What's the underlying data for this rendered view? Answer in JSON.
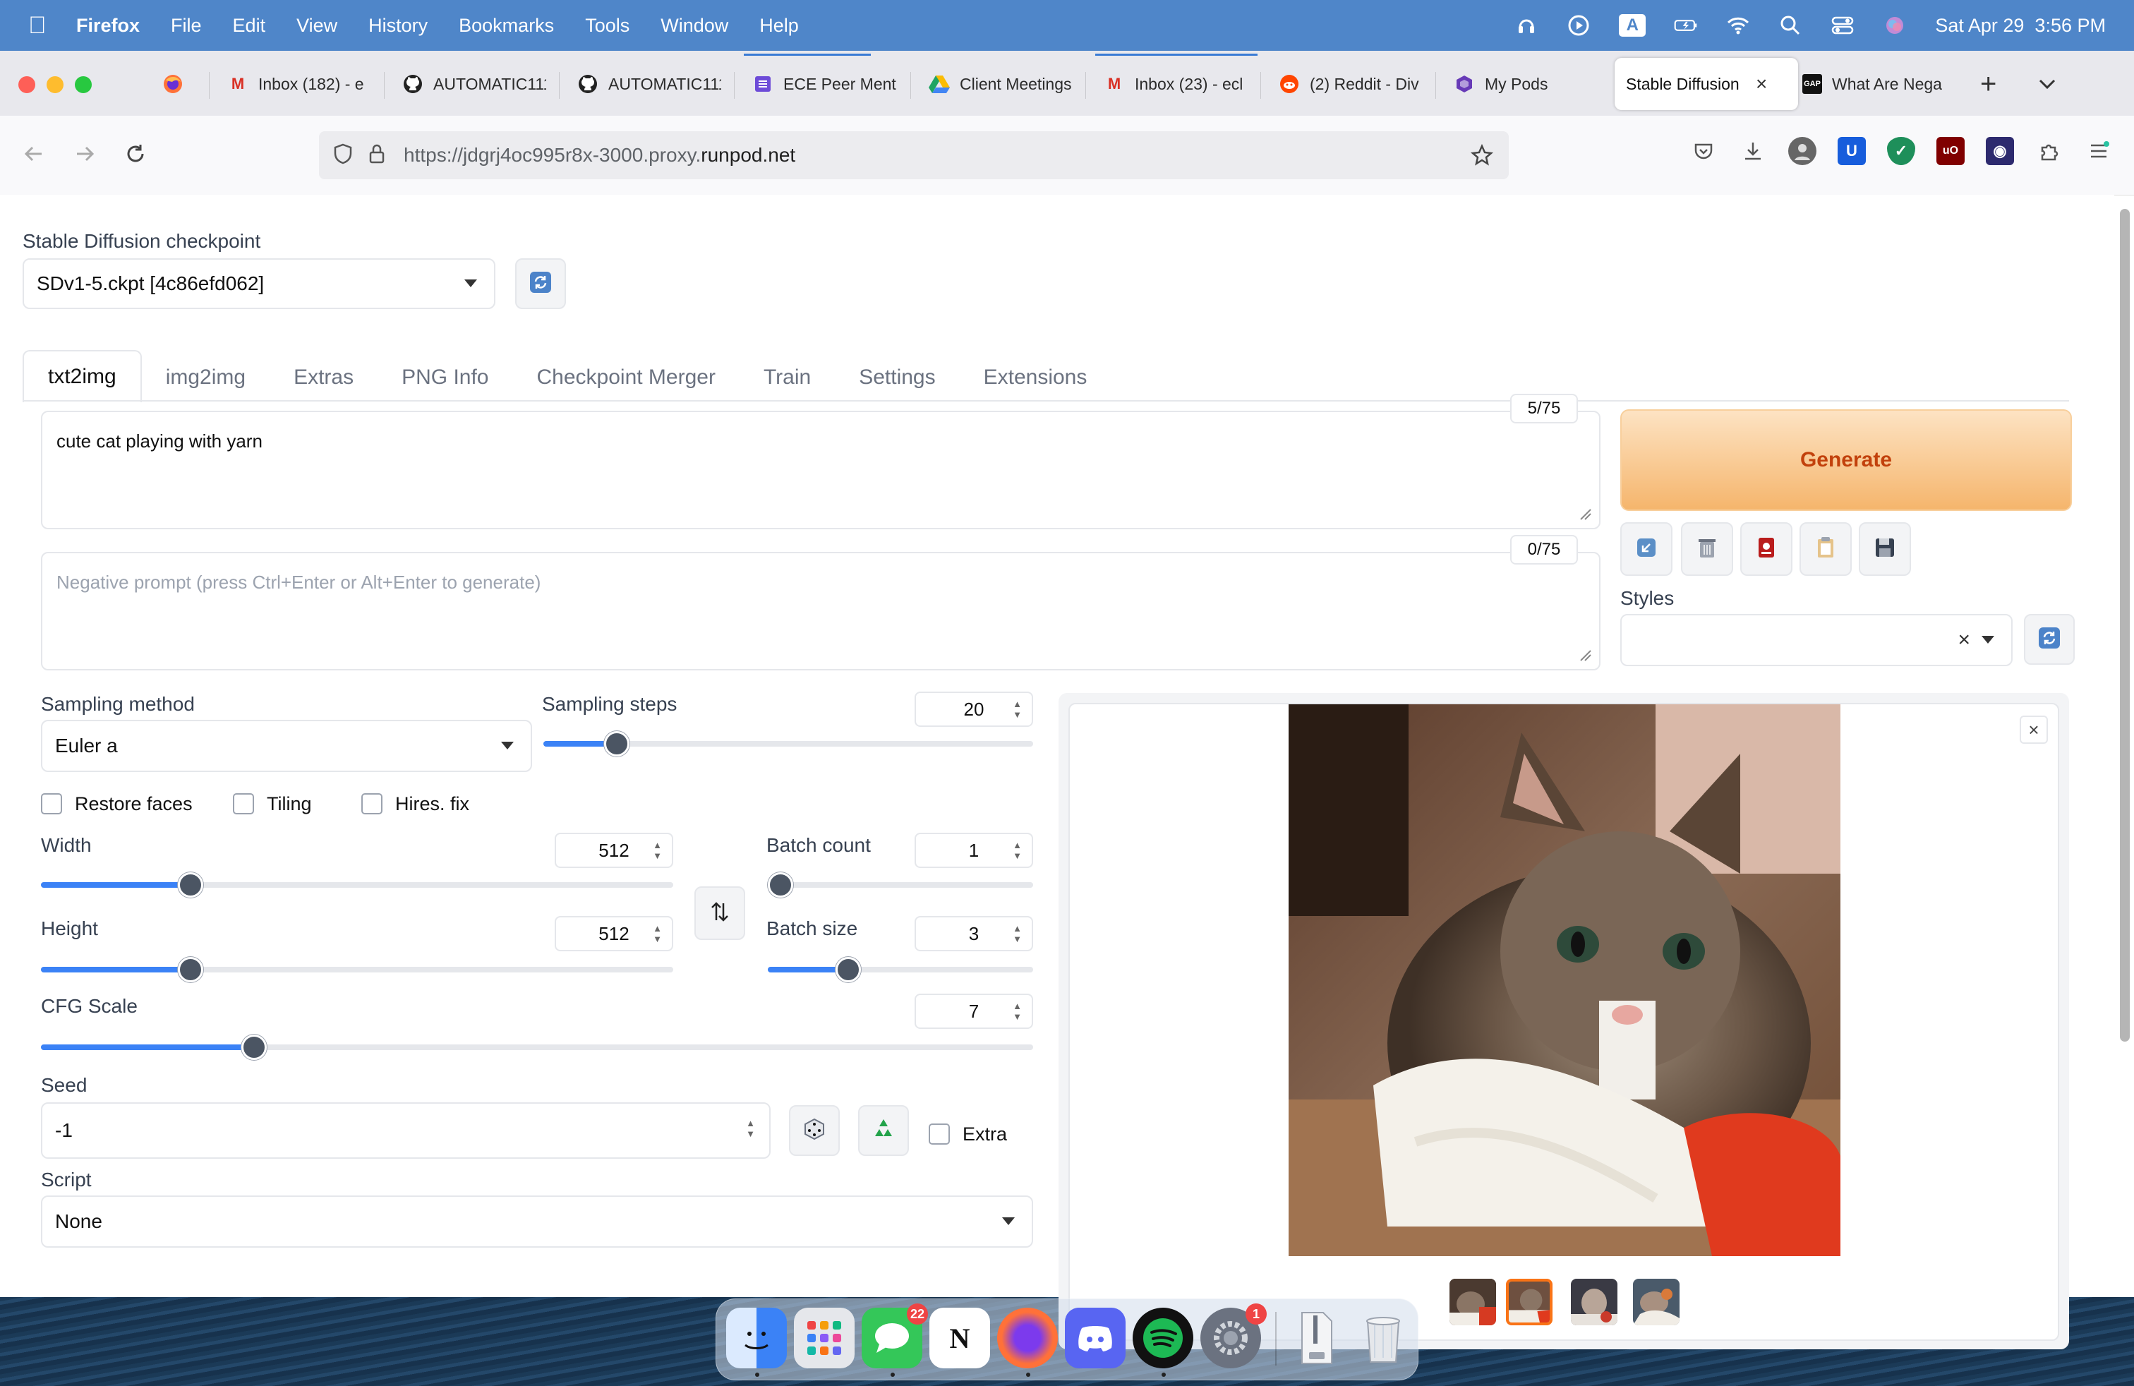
{
  "menubar": {
    "app_name": "Firefox",
    "items": [
      "File",
      "Edit",
      "View",
      "History",
      "Bookmarks",
      "Tools",
      "Window",
      "Help"
    ],
    "datetime": "Sat Apr 29  3:56 PM",
    "input_source": "A"
  },
  "browser": {
    "tabs": [
      {
        "title": "Inbox (182) - e",
        "icon": "gmail-icon"
      },
      {
        "title": "AUTOMATIC111",
        "icon": "github-icon"
      },
      {
        "title": "AUTOMATIC111",
        "icon": "github-icon"
      },
      {
        "title": "ECE Peer Ment",
        "icon": "form-icon"
      },
      {
        "title": "Client Meetings",
        "icon": "google-drive-icon"
      },
      {
        "title": "Inbox (23) - ecl",
        "icon": "gmail-icon"
      },
      {
        "title": "(2) Reddit - Div",
        "icon": "reddit-icon"
      },
      {
        "title": "My Pods",
        "icon": "runpod-icon"
      },
      {
        "title": "Stable Diffusion",
        "icon": "none",
        "active": true
      },
      {
        "title": "What Are Nega",
        "icon": "gap-icon"
      }
    ],
    "url_prefix": "https://jdgrj4oc995r8x-3000.proxy.",
    "url_domain": "runpod.net"
  },
  "app": {
    "checkpoint_label": "Stable Diffusion checkpoint",
    "checkpoint_value": "SDv1-5.ckpt [4c86efd062]",
    "tabs": [
      "txt2img",
      "img2img",
      "Extras",
      "PNG Info",
      "Checkpoint Merger",
      "Train",
      "Settings",
      "Extensions"
    ],
    "prompt": "cute cat playing with yarn",
    "prompt_counter": "5/75",
    "negative_placeholder": "Negative prompt (press Ctrl+Enter or Alt+Enter to generate)",
    "negative_counter": "0/75",
    "generate_label": "Generate",
    "styles_label": "Styles",
    "sampling_method_label": "Sampling method",
    "sampling_method_value": "Euler a",
    "sampling_steps_label": "Sampling steps",
    "sampling_steps_value": "20",
    "checkboxes": [
      "Restore faces",
      "Tiling",
      "Hires. fix"
    ],
    "width_label": "Width",
    "width_value": "512",
    "height_label": "Height",
    "height_value": "512",
    "batch_count_label": "Batch count",
    "batch_count_value": "1",
    "batch_size_label": "Batch size",
    "batch_size_value": "3",
    "cfg_label": "CFG Scale",
    "cfg_value": "7",
    "seed_label": "Seed",
    "seed_value": "-1",
    "extra_label": "Extra",
    "script_label": "Script",
    "script_value": "None"
  },
  "dock": {
    "messages_badge": "22",
    "settings_badge": "1"
  },
  "colors": {
    "accent": "#3b82f6",
    "generate_text": "#c2410c",
    "menubar": "#4f86c9"
  }
}
